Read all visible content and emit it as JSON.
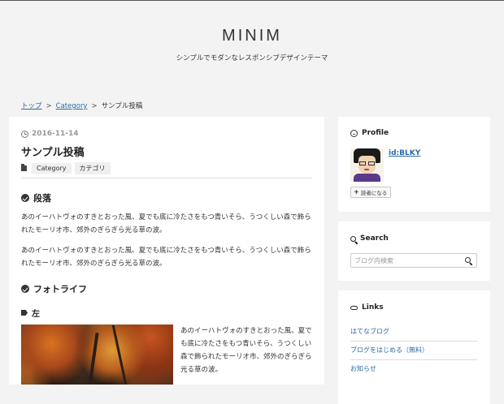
{
  "site": {
    "title": "MINIM",
    "description": "シンプルでモダンなレスポンシブデザインテーマ"
  },
  "breadcrumb": {
    "items": [
      "トップ",
      "Category",
      "サンプル投稿"
    ],
    "separator": ">"
  },
  "entry": {
    "date": "2016-11-14",
    "title": "サンプル投稿",
    "categories": [
      "Category",
      "カテゴリ"
    ],
    "sections": [
      {
        "heading": "段落",
        "paragraphs": [
          "あのイーハトヴォのすきとおった風、夏でも底に冷たさをもつ青いそら、うつくしい森で飾られたモーリオ市、郊外のぎらぎら光る草の波。",
          "あのイーハトヴォのすきとおった風、夏でも底に冷たさをもつ青いそら、うつくしい森で飾られたモーリオ市、郊外のぎらぎら光る草の波。"
        ]
      },
      {
        "heading": "フォトライフ",
        "subheading": "左",
        "float_text": "あのイーハトヴォのすきとおった風、夏でも底に冷たさをもつ青いそら、うつくしい森で飾られたモーリオ市、郊外のぎらぎら光る草の波。"
      }
    ]
  },
  "sidebar": {
    "profile": {
      "title": "Profile",
      "username": "id:BLKY",
      "reader_button": "読者になる"
    },
    "search": {
      "title": "Search",
      "placeholder": "ブログ内検索"
    },
    "links": {
      "title": "Links",
      "items": [
        "はてなブログ",
        "ブログをはじめる（無料）",
        "お知らせ"
      ]
    }
  },
  "colors": {
    "background": "#f3f3f3",
    "card": "#ffffff",
    "link": "#2b6aa8",
    "text": "#333333"
  }
}
